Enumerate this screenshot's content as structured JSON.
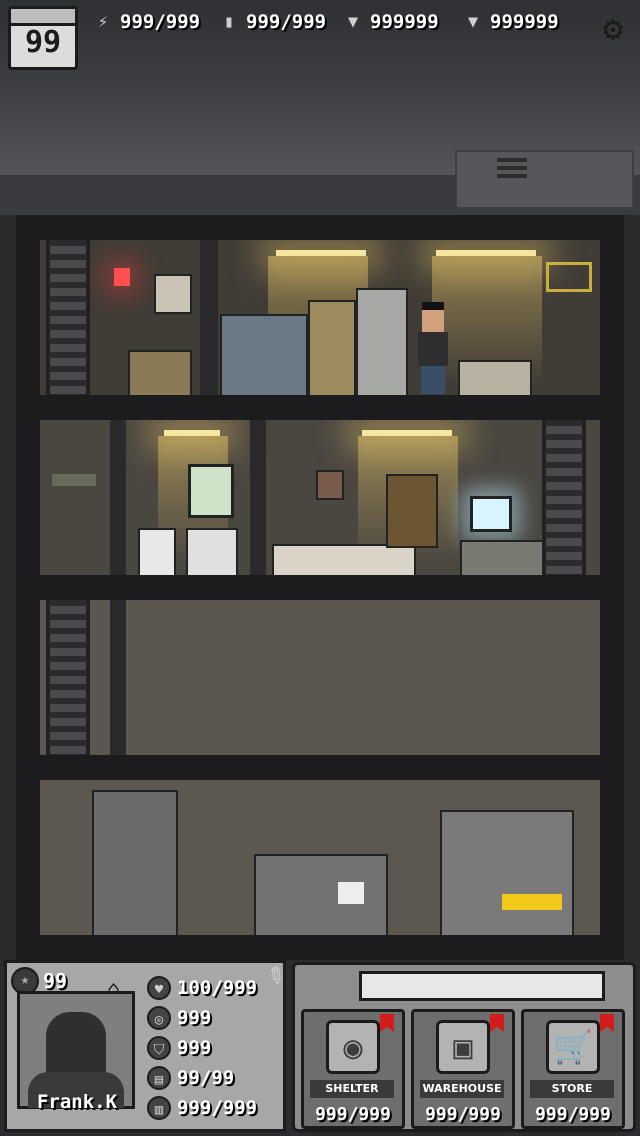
{
  "hud": {
    "day": "99",
    "resources": [
      {
        "icon": "energy-icon",
        "value": "999/999"
      },
      {
        "icon": "water-icon",
        "value": "999/999"
      },
      {
        "icon": "bolt-icon",
        "value": "999999"
      },
      {
        "icon": "screw-icon",
        "value": "999999"
      }
    ]
  },
  "character": {
    "level": "99",
    "name": "Frank.K",
    "stats": [
      {
        "icon": "heart-icon",
        "value": "100/999"
      },
      {
        "icon": "target-icon",
        "value": "999"
      },
      {
        "icon": "shield-icon",
        "value": "999"
      },
      {
        "icon": "food-can-icon",
        "value": "99/99"
      },
      {
        "icon": "water-jar-icon",
        "value": "999/999"
      }
    ]
  },
  "menu": {
    "buttons": [
      {
        "label": "SHELTER",
        "value": "999/999",
        "icon": "shelter-icon"
      },
      {
        "label": "WAREHOUSE",
        "value": "999/999",
        "icon": "box-icon"
      },
      {
        "label": "STORE",
        "value": "999/999",
        "icon": "cart-icon"
      }
    ]
  },
  "colors": {
    "notification_flag": "#d51c1c",
    "lamp_light": "#f6e7a0",
    "shelter_frame": "#1c1c1e"
  }
}
